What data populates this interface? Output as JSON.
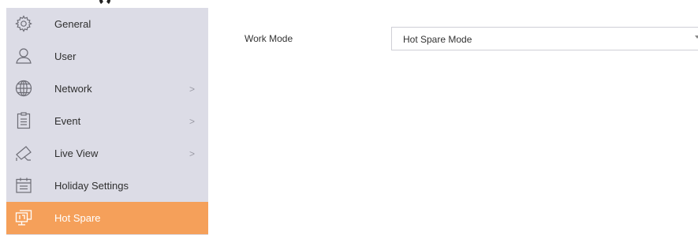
{
  "sidebar": {
    "items": [
      {
        "label": "General",
        "icon": "gear-icon",
        "chevron": "",
        "active": false
      },
      {
        "label": "User",
        "icon": "user-icon",
        "chevron": "",
        "active": false
      },
      {
        "label": "Network",
        "icon": "globe-icon",
        "chevron": ">",
        "active": false
      },
      {
        "label": "Event",
        "icon": "clipboard-icon",
        "chevron": ">",
        "active": false
      },
      {
        "label": "Live View",
        "icon": "camera-icon",
        "chevron": ">",
        "active": false
      },
      {
        "label": "Holiday Settings",
        "icon": "calendar-icon",
        "chevron": "",
        "active": false
      },
      {
        "label": "Hot Spare",
        "icon": "hot-spare-icon",
        "chevron": "",
        "active": true
      }
    ]
  },
  "main": {
    "work_mode": {
      "label": "Work Mode",
      "value": "Hot Spare Mode"
    }
  },
  "colors": {
    "sidebar_bg": "#dcdce6",
    "active_bg": "#f5a05a"
  }
}
